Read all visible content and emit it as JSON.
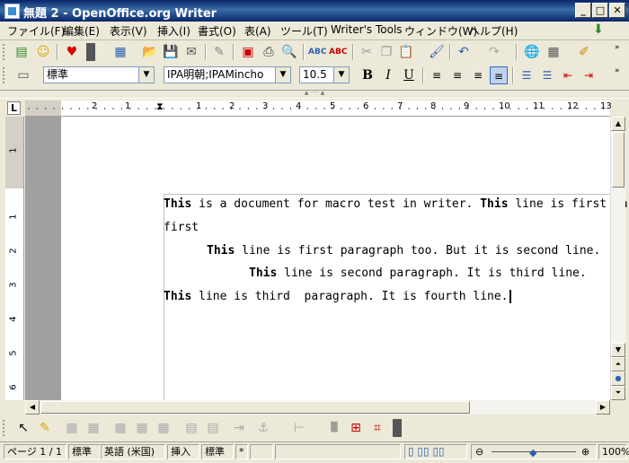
{
  "window": {
    "title": "無題 2 - OpenOffice.org Writer",
    "min": "_",
    "max": "□",
    "close": "✕"
  },
  "menu": [
    "ファイル(F)",
    "編集(E)",
    "表示(V)",
    "挿入(I)",
    "書式(O)",
    "表(A)",
    "ツール(T)",
    "Writer's Tools",
    "ウィンドウ(W)",
    "ヘルプ(H)"
  ],
  "formatting": {
    "style": "標準",
    "font": "IPA明朝;IPAMincho",
    "size": "10.5",
    "bold": "B",
    "italic": "I",
    "underline": "U"
  },
  "ruler": {
    "h_labels": [
      "2",
      "1",
      "1",
      "2",
      "3",
      "4",
      "5",
      "6",
      "7",
      "8",
      "9",
      "10",
      "11",
      "12",
      "13"
    ],
    "v_labels": [
      "1",
      "1",
      "2",
      "3",
      "4",
      "5",
      "6"
    ]
  },
  "document": {
    "lines": [
      {
        "bold": "This",
        "rest": " is a document for macro test in writer. ",
        "bold2": "This",
        "rest2": " line is first para"
      },
      {
        "bold": "",
        "rest": "first",
        "bold2": "",
        "rest2": ""
      },
      {
        "bold": "This",
        "rest": " line is first paragraph too. But it is second line.",
        "bold2": "",
        "rest2": ""
      },
      {
        "bold": "This",
        "rest": " line is second paragraph. It is third line.",
        "bold2": "",
        "rest2": ""
      },
      {
        "bold": "This",
        "rest": " line is third  paragraph. It is fourth line.",
        "bold2": "",
        "rest2": ""
      }
    ]
  },
  "status": {
    "page": "ページ 1 / 1",
    "page_style": "標準",
    "language": "英語 (米国)",
    "insert_mode": "挿入",
    "selection_mode": "標準",
    "modified": "*",
    "zoom": "100%"
  }
}
